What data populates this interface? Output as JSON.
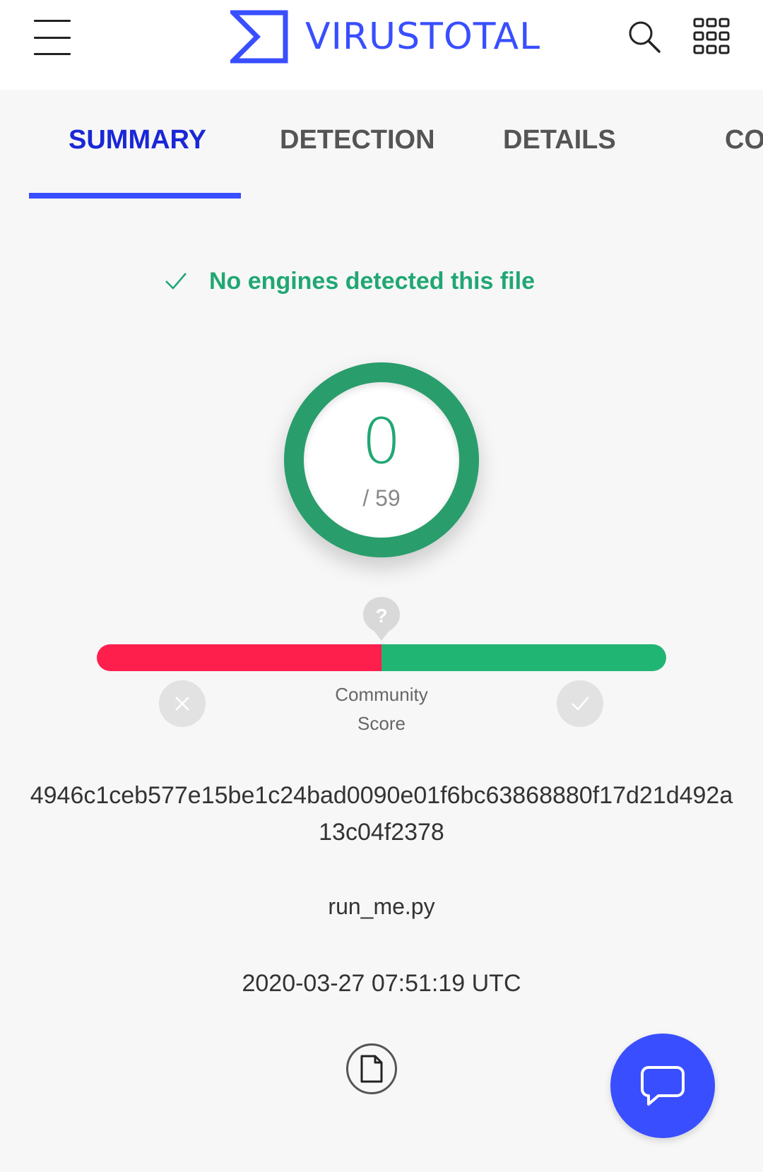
{
  "header": {
    "logo_text": "VIRUSTOTAL",
    "brand_color": "#394eff",
    "icons": [
      "menu-icon",
      "virustotal-logo-icon",
      "search-icon",
      "apps-grid-icon"
    ]
  },
  "tabs": [
    {
      "label": "SUMMARY",
      "active": true
    },
    {
      "label": "DETECTION",
      "active": false
    },
    {
      "label": "DETAILS",
      "active": false
    },
    {
      "label": "CO",
      "active": false
    }
  ],
  "verdict": {
    "text": "No engines detected this file",
    "color": "#21a774",
    "icon": "check-icon"
  },
  "detection_ratio": {
    "positives": "0",
    "total": "/ 59",
    "ring_color": "#2a9d6c"
  },
  "community_score": {
    "label_line1": "Community",
    "label_line2": "Score",
    "marker_text": "?",
    "negative_fraction": 0.5,
    "negative_color": "#ff1f4d",
    "positive_color": "#21b573"
  },
  "file": {
    "hash": "4946c1ceb577e15be1c24bad0090e01f6bc63868880f17d21d492a13c04f2378",
    "name": "run_me.py",
    "scan_date": "2020-03-27 07:51:19 UTC",
    "type_icon": "file-icon"
  },
  "chat": {
    "icon": "chat-bubble-icon"
  }
}
